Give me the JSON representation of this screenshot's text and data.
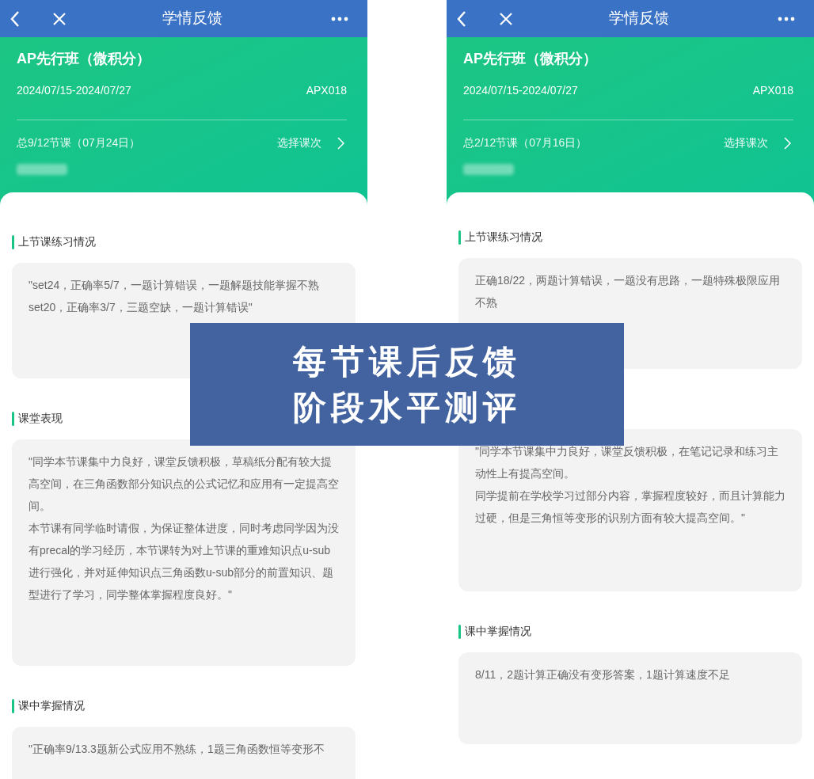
{
  "phones": [
    {
      "nav": {
        "title": "学情反馈"
      },
      "course": {
        "name": "AP先行班（微积分）",
        "dates": "2024/07/15-2024/07/27",
        "code": "APX018",
        "lesson": "总9/12节课（07月24日）",
        "select_label": "选择课次"
      },
      "sections": [
        {
          "title": "上节课练习情况",
          "paragraphs": [
            "\"set24，正确率5/7，一题计算错误，一题解题技能掌握不熟",
            "set20，正确率3/7，三题空缺，一题计算错误\""
          ]
        },
        {
          "title": "课堂表现",
          "paragraphs": [
            "\"同学本节课集中力良好，课堂反馈积极，草稿纸分配有较大提高空间，在三角函数部分知识点的公式记忆和应用有一定提高空间。",
            "本节课有同学临时请假，为保证整体进度，同时考虑同学因为没有precal的学习经历，本节课转为对上节课的重难知识点u-sub进行强化，并对延伸知识点三角函数u-sub部分的前置知识、题型进行了学习，同学整体掌握程度良好。\""
          ]
        },
        {
          "title": "课中掌握情况",
          "paragraphs": [
            "\"正确率9/13.3题新公式应用不熟练，1题三角函数恒等变形不"
          ]
        }
      ]
    },
    {
      "nav": {
        "title": "学情反馈"
      },
      "course": {
        "name": "AP先行班（微积分）",
        "dates": "2024/07/15-2024/07/27",
        "code": "APX018",
        "lesson": "总2/12节课（07月16日）",
        "select_label": "选择课次"
      },
      "sections": [
        {
          "title": "上节课练习情况",
          "paragraphs": [
            "正确18/22，两题计算错误，一题没有思路，一题特殊极限应用不熟"
          ]
        },
        {
          "paragraphs": [
            "\"同学本节课集中力良好，课堂反馈积极，在笔记记录和练习主动性上有提高空间。",
            "同学提前在学校学习过部分内容，掌握程度较好，而且计算能力过硬，但是三角恒等变形的识别方面有较大提高空间。\""
          ]
        },
        {
          "title": "课中掌握情况",
          "paragraphs": [
            "8/11，2题计算正确没有变形答案，1题计算速度不足"
          ]
        }
      ]
    }
  ],
  "banner": {
    "lines": [
      "每节课后反馈",
      "阶段水平测评"
    ]
  }
}
